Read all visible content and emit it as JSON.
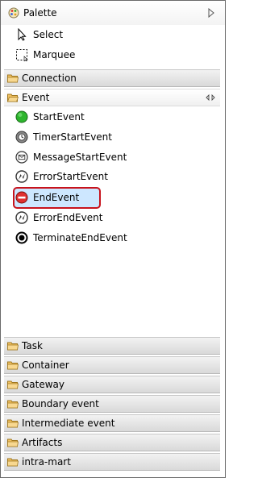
{
  "header": {
    "title": "Palette"
  },
  "tools": [
    {
      "label": "Select",
      "icon": "arrow-cursor-icon"
    },
    {
      "label": "Marquee",
      "icon": "marquee-icon"
    }
  ],
  "drawers_top": [
    {
      "label": "Connection",
      "open": false
    },
    {
      "label": "Event",
      "open": true
    }
  ],
  "event_items": [
    {
      "label": "StartEvent",
      "icon": "start-event-icon"
    },
    {
      "label": "TimerStartEvent",
      "icon": "timer-start-event-icon"
    },
    {
      "label": "MessageStartEvent",
      "icon": "message-start-event-icon"
    },
    {
      "label": "ErrorStartEvent",
      "icon": "error-start-event-icon"
    },
    {
      "label": "EndEvent",
      "icon": "end-event-icon",
      "selected": true
    },
    {
      "label": "ErrorEndEvent",
      "icon": "error-end-event-icon"
    },
    {
      "label": "TerminateEndEvent",
      "icon": "terminate-end-event-icon"
    }
  ],
  "drawers_bottom": [
    {
      "label": "Task"
    },
    {
      "label": "Container"
    },
    {
      "label": "Gateway"
    },
    {
      "label": "Boundary event"
    },
    {
      "label": "Intermediate event"
    },
    {
      "label": "Artifacts"
    },
    {
      "label": "intra-mart"
    }
  ],
  "colors": {
    "selection_bg": "#cde7ff",
    "highlight_border": "#c8131d",
    "folder": "#f0c060"
  }
}
